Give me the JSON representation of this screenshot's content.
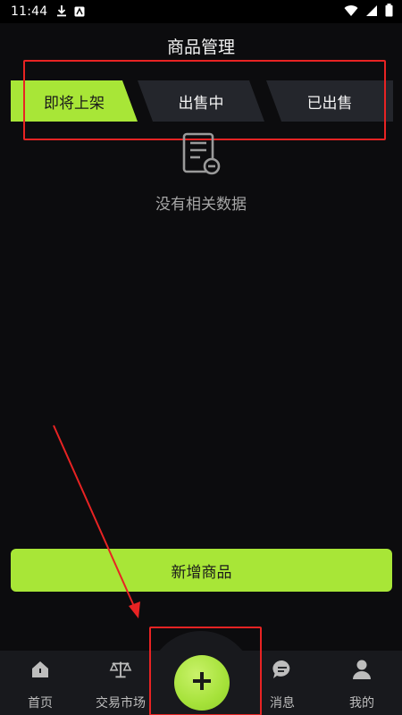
{
  "status_bar": {
    "time": "11:44"
  },
  "header": {
    "title": "商品管理"
  },
  "tabs": [
    {
      "label": "即将上架",
      "active": true
    },
    {
      "label": "出售中",
      "active": false
    },
    {
      "label": "已出售",
      "active": false
    }
  ],
  "empty_state": {
    "text": "没有相关数据",
    "icon": "empty-document-icon"
  },
  "add_button": {
    "label": "新增商品"
  },
  "bottom_nav": {
    "items": [
      {
        "label": "首页",
        "icon": "home-icon"
      },
      {
        "label": "交易市场",
        "icon": "scale-icon"
      },
      {
        "label": "消息",
        "icon": "chat-icon"
      },
      {
        "label": "我的",
        "icon": "user-icon"
      }
    ],
    "center_icon": "plus-icon"
  },
  "colors": {
    "accent": "#a8e637",
    "background": "#0c0c0e",
    "annotation": "#e82323"
  }
}
